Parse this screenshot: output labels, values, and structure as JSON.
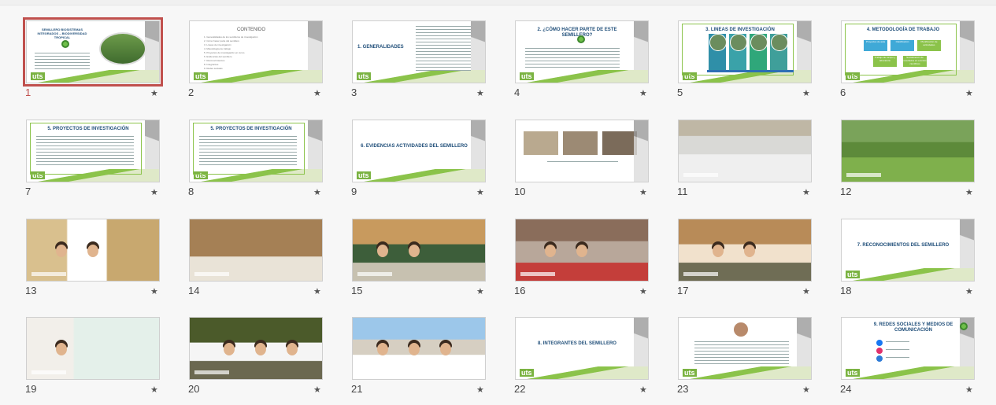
{
  "slides": [
    {
      "number": "1",
      "star": "★",
      "title": "SEMILLERO BIOSISTEMAS INTEGRADOS – BIODIVERSIDAD TROPICAL",
      "selected": true
    },
    {
      "number": "2",
      "star": "★",
      "title": "CONTENIDO",
      "items": [
        "1. Generalidades de los semilleros de investigación",
        "2. Cómo hacer parte del semillero",
        "3. Líneas de investigación",
        "4. Metodología de trabajo",
        "5. Proyectos de investigación en curso",
        "6. Evidencias del semillero",
        "7. Reconocimientos",
        "8. Integrantes",
        "9. Redes sociales"
      ]
    },
    {
      "number": "3",
      "star": "★",
      "title": "1. GENERALIDADES"
    },
    {
      "number": "4",
      "star": "★",
      "title": "2. ¿CÓMO HACER PARTE DE ESTE SEMILLERO?",
      "logo": "BIOTRÓP"
    },
    {
      "number": "5",
      "star": "★",
      "title": "3. LINEAS DE INVESTIGACIÓN"
    },
    {
      "number": "6",
      "star": "★",
      "title": "4. METODOLOGÍA DE TRABAJO",
      "boxes": [
        "Proyectos de aula",
        "Clasificación",
        "Planificación de actividades",
        "Trabajo de campo y laboratorio",
        "Socialización de resultados en eventos científicos"
      ]
    },
    {
      "number": "7",
      "star": "★",
      "title": "5. PROYECTOS DE INVESTIGACIÓN"
    },
    {
      "number": "8",
      "star": "★",
      "title": "5. PROYECTOS DE INVESTIGACIÓN"
    },
    {
      "number": "9",
      "star": "★",
      "title": "6. EVIDENCIAS ACTIVIDADES DEL SEMILLERO"
    },
    {
      "number": "10",
      "star": "★",
      "title": ""
    },
    {
      "number": "11",
      "star": "★",
      "title": ""
    },
    {
      "number": "12",
      "star": "★",
      "title": ""
    },
    {
      "number": "13",
      "star": "★",
      "title": ""
    },
    {
      "number": "14",
      "star": "★",
      "title": ""
    },
    {
      "number": "15",
      "star": "★",
      "title": ""
    },
    {
      "number": "16",
      "star": "★",
      "title": ""
    },
    {
      "number": "17",
      "star": "★",
      "title": ""
    },
    {
      "number": "18",
      "star": "★",
      "title": "7. RECONOCIMIENTOS DEL SEMILLERO"
    },
    {
      "number": "19",
      "star": "★",
      "title": ""
    },
    {
      "number": "20",
      "star": "★",
      "title": ""
    },
    {
      "number": "21",
      "star": "★",
      "title": ""
    },
    {
      "number": "22",
      "star": "★",
      "title": "8. INTEGRANTES DEL SEMILLERO"
    },
    {
      "number": "23",
      "star": "★",
      "title": ""
    },
    {
      "number": "24",
      "star": "★",
      "title": "9. REDES SOCIALES Y MEDIOS DE COMUNICACIÓN"
    }
  ],
  "brand": {
    "uts": "uts",
    "accent": "#8bc34a",
    "selected": "#c0504d"
  }
}
